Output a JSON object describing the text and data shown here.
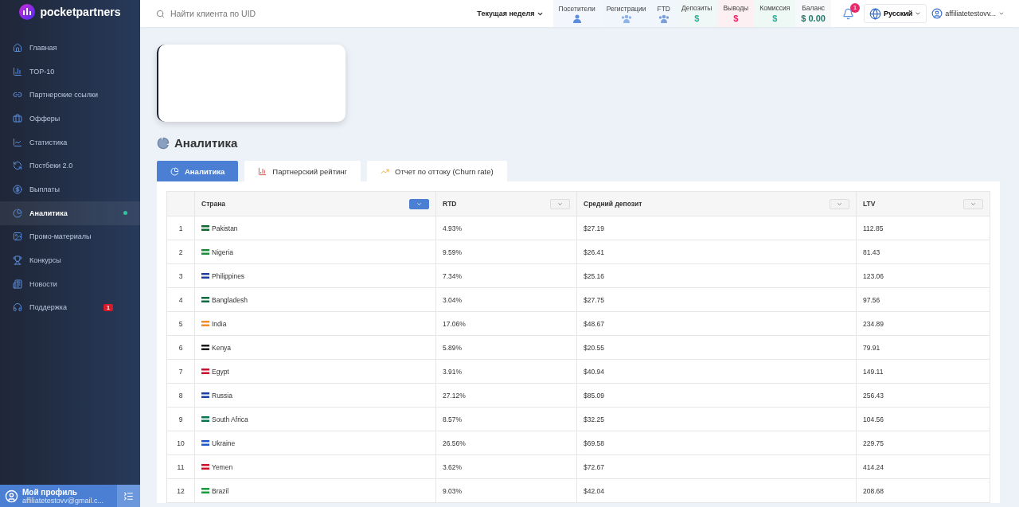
{
  "brand": "pocketpartners",
  "sidebar": {
    "items": [
      {
        "label": "Главная",
        "selected": false
      },
      {
        "label": "TOP-10",
        "selected": false
      },
      {
        "label": "Партнерские ссылки",
        "selected": false
      },
      {
        "label": "Офферы",
        "selected": false
      },
      {
        "label": "Статистика",
        "selected": false
      },
      {
        "label": "Постбеки 2.0",
        "selected": false
      },
      {
        "label": "Выплаты",
        "selected": false
      },
      {
        "label": "Аналитика",
        "selected": true
      },
      {
        "label": "Промо-материалы",
        "selected": false
      },
      {
        "label": "Конкурсы",
        "selected": false
      },
      {
        "label": "Новости",
        "selected": false
      },
      {
        "label": "Поддержка",
        "selected": false,
        "badge": "1"
      }
    ],
    "profile": {
      "title": "Мой профиль",
      "email": "affiliatetestovv@gmail.c..."
    }
  },
  "header": {
    "search": {
      "placeholder": "Найти клиента по UID"
    },
    "period": "Текущая неделя",
    "metrics": [
      {
        "label": "Посетители",
        "kind": "user",
        "color": "#5b8de0"
      },
      {
        "label": "Регистрации",
        "kind": "users",
        "color": "#8fb4ea"
      },
      {
        "label": "FTD",
        "kind": "users",
        "color": "#7a9fd8"
      },
      {
        "label": "Депозиты",
        "kind": "dollar",
        "value": "$",
        "color": "#22b59a"
      },
      {
        "label": "Выводы",
        "kind": "dollar",
        "value": "$",
        "color": "#e8296b"
      },
      {
        "label": "Комиссия",
        "kind": "dollar",
        "value": "$",
        "color": "#22b59a"
      },
      {
        "label": "Баланс",
        "kind": "value",
        "value": "$ 0.00",
        "color": "#1e7a6a"
      }
    ],
    "notifications": "1",
    "language": "Русский",
    "user": "affiliatetestovv..."
  },
  "page": {
    "title": "Аналитика",
    "tabs": [
      {
        "label": "Аналитика",
        "selected": true
      },
      {
        "label": "Партнерский рейтинг",
        "selected": false
      },
      {
        "label": "Отчет по оттоку (Churn rate)",
        "selected": false
      }
    ],
    "table": {
      "columns": [
        {
          "label": "Страна",
          "sorted": true
        },
        {
          "label": "RTD",
          "sorted": false
        },
        {
          "label": "Средний депозит",
          "sorted": false
        },
        {
          "label": "LTV",
          "sorted": false
        }
      ],
      "rows": [
        {
          "index": "1",
          "country": "Pakistan",
          "color": "#0b6b2e",
          "rtd": "4.93%",
          "deposit": "$27.19",
          "ltv": "112.85"
        },
        {
          "index": "2",
          "country": "Nigeria",
          "color": "#1b8a3a",
          "rtd": "9.59%",
          "deposit": "$26.41",
          "ltv": "81.43"
        },
        {
          "index": "3",
          "country": "Philippines",
          "color": "#1f3f9f",
          "rtd": "7.34%",
          "deposit": "$25.16",
          "ltv": "123.06"
        },
        {
          "index": "4",
          "country": "Bangladesh",
          "color": "#0a6a3e",
          "rtd": "3.04%",
          "deposit": "$27.75",
          "ltv": "97.56"
        },
        {
          "index": "5",
          "country": "India",
          "color": "#f28c28",
          "rtd": "17.06%",
          "deposit": "$48.67",
          "ltv": "234.89"
        },
        {
          "index": "6",
          "country": "Kenya",
          "color": "#1a1a1a",
          "rtd": "5.89%",
          "deposit": "$20.55",
          "ltv": "79.91"
        },
        {
          "index": "7",
          "country": "Egypt",
          "color": "#c8102e",
          "rtd": "3.91%",
          "deposit": "$40.94",
          "ltv": "149.11"
        },
        {
          "index": "8",
          "country": "Russia",
          "color": "#1c3fa8",
          "rtd": "27.12%",
          "deposit": "$85.09",
          "ltv": "256.43"
        },
        {
          "index": "9",
          "country": "South Africa",
          "color": "#007a4d",
          "rtd": "8.57%",
          "deposit": "$32.25",
          "ltv": "104.56"
        },
        {
          "index": "10",
          "country": "Ukraine",
          "color": "#2057c8",
          "rtd": "26.56%",
          "deposit": "$69.58",
          "ltv": "229.75"
        },
        {
          "index": "11",
          "country": "Yemen",
          "color": "#ce1126",
          "rtd": "3.62%",
          "deposit": "$72.67",
          "ltv": "414.24"
        },
        {
          "index": "12",
          "country": "Brazil",
          "color": "#169b3a",
          "rtd": "9.03%",
          "deposit": "$42.04",
          "ltv": "208.68"
        }
      ]
    }
  }
}
